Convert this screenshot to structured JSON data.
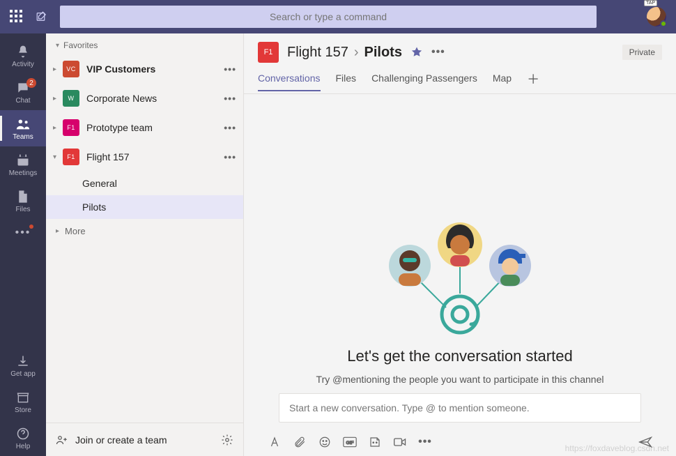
{
  "titlebar": {
    "search_placeholder": "Search or type a command",
    "avatar_tag": "TAP"
  },
  "rail": {
    "items": [
      {
        "id": "activity",
        "label": "Activity",
        "badge": null
      },
      {
        "id": "chat",
        "label": "Chat",
        "badge": "2"
      },
      {
        "id": "teams",
        "label": "Teams",
        "badge": null,
        "active": true
      },
      {
        "id": "meetings",
        "label": "Meetings",
        "badge": null
      },
      {
        "id": "files",
        "label": "Files",
        "badge": null
      }
    ],
    "bottom": [
      {
        "id": "getapp",
        "label": "Get app"
      },
      {
        "id": "store",
        "label": "Store"
      },
      {
        "id": "help",
        "label": "Help"
      }
    ]
  },
  "teams_panel": {
    "favorites_label": "Favorites",
    "teams": [
      {
        "name": "VIP Customers",
        "abbr": "VC",
        "color": "#cc4a31",
        "bold": true
      },
      {
        "name": "Corporate News",
        "abbr": "W",
        "color": "#2a8a5f",
        "bold": false
      },
      {
        "name": "Prototype team",
        "abbr": "F1",
        "color": "#d6006c",
        "bold": false
      },
      {
        "name": "Flight 157",
        "abbr": "F1",
        "color": "#e23838",
        "bold": false,
        "expanded": true,
        "channels": [
          {
            "name": "General",
            "selected": false
          },
          {
            "name": "Pilots",
            "selected": true
          }
        ]
      }
    ],
    "more_label": "More",
    "footer_label": "Join or create a team"
  },
  "channel_header": {
    "team_abbr": "F1",
    "team_name": "Flight 157",
    "channel_name": "Pilots",
    "privacy": "Private"
  },
  "tabs": {
    "items": [
      {
        "label": "Conversations",
        "active": true
      },
      {
        "label": "Files"
      },
      {
        "label": "Challenging Passengers"
      },
      {
        "label": "Map"
      }
    ]
  },
  "empty_state": {
    "title": "Let's get the conversation started",
    "subtitle": "Try @mentioning the people you want to participate in this channel"
  },
  "composer": {
    "placeholder": "Start a new conversation. Type @ to mention someone."
  },
  "watermark": "https://foxdaveblog.csdn.net",
  "colors": {
    "brand": "#464775",
    "accent": "#6264a7",
    "teal": "#3aa89b"
  }
}
